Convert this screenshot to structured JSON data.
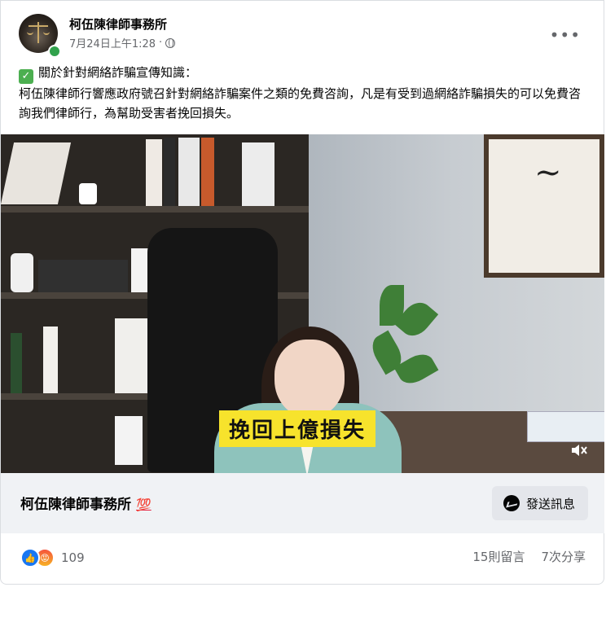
{
  "post": {
    "page_name": "柯伍陳律師事務所",
    "timestamp": "7月24日上午1:28",
    "audience_icon": "globe-icon",
    "menu_icon": "more-options-icon",
    "text_line1": "關於針對網絡詐騙宣傳知識：",
    "text_body": "柯伍陳律師行響應政府號召針對網絡詐騙案件之類的免費咨詢，凡是有受到過網絡詐騙損失的可以免費咨詢我們律師行，為幫助受害者挽回損失。"
  },
  "video": {
    "caption": "挽回上億損失",
    "mute_icon": "speaker-muted-icon"
  },
  "footer": {
    "page_name": "柯伍陳律師事務所",
    "emoji": "💯",
    "send_message_label": "發送訊息"
  },
  "engagement": {
    "reaction_count": "109",
    "comments": "15則留言",
    "shares": "7次分享"
  },
  "colors": {
    "accent": "#1877f2",
    "caption_bg": "#f7e32c",
    "footer_bg": "#f0f2f5"
  }
}
